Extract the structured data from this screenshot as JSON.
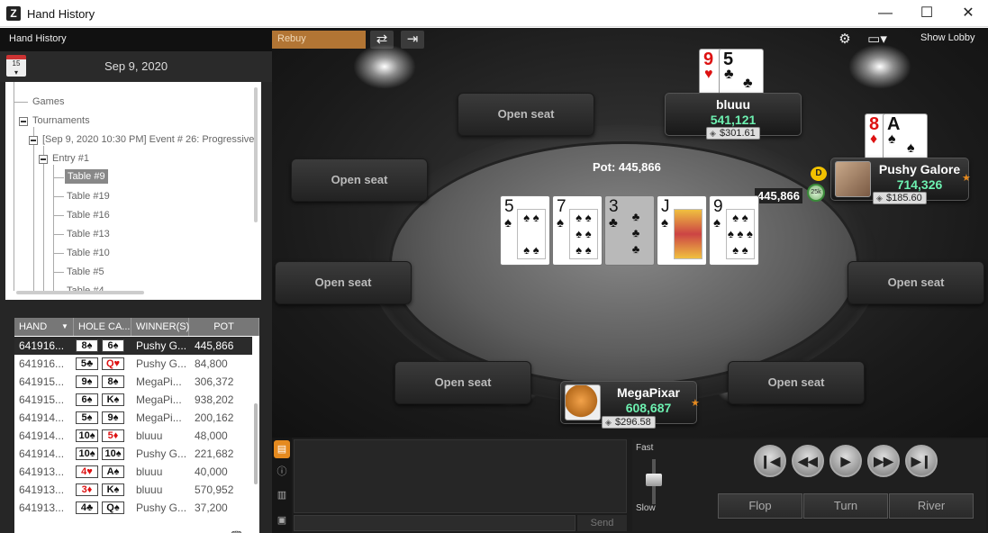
{
  "window": {
    "title": "Hand History",
    "min": "—",
    "max": "☐",
    "close": "✕"
  },
  "left": {
    "header": "Hand History",
    "date": "Sep 9, 2020",
    "calendar_day": "15",
    "tree": {
      "games": "Games",
      "tournaments": "Tournaments",
      "event": "[Sep 9, 2020 10:30 PM] Event # 26: Progressive",
      "entry": "Entry #1",
      "tables": [
        "Table #9",
        "Table #19",
        "Table #16",
        "Table #13",
        "Table #10",
        "Table #5",
        "Table #4"
      ]
    },
    "columns": [
      "HAND",
      "HOLE CA...",
      "WINNER(S)",
      "POT"
    ],
    "rows": [
      {
        "hand": "641916...",
        "c1": "8♠",
        "c1red": false,
        "c2": "6♠",
        "c2red": false,
        "winner": "Pushy G...",
        "pot": "445,866"
      },
      {
        "hand": "641916...",
        "c1": "5♣",
        "c1red": false,
        "c2": "Q♥",
        "c2red": true,
        "winner": "Pushy G...",
        "pot": "84,800"
      },
      {
        "hand": "641915...",
        "c1": "9♠",
        "c1red": false,
        "c2": "8♠",
        "c2red": false,
        "winner": "MegaPi...",
        "pot": "306,372"
      },
      {
        "hand": "641915...",
        "c1": "6♠",
        "c1red": false,
        "c2": "K♠",
        "c2red": false,
        "winner": "MegaPi...",
        "pot": "938,202"
      },
      {
        "hand": "641914...",
        "c1": "5♠",
        "c1red": false,
        "c2": "9♠",
        "c2red": false,
        "winner": "MegaPi...",
        "pot": "200,162"
      },
      {
        "hand": "641914...",
        "c1": "10♠",
        "c1red": false,
        "c2": "5♦",
        "c2red": true,
        "winner": "bluuu",
        "pot": "48,000"
      },
      {
        "hand": "641914...",
        "c1": "10♠",
        "c1red": false,
        "c2": "10♠",
        "c2red": false,
        "winner": "Pushy G...",
        "pot": "221,682"
      },
      {
        "hand": "641913...",
        "c1": "4♥",
        "c1red": true,
        "c2": "A♠",
        "c2red": false,
        "winner": "bluuu",
        "pot": "40,000"
      },
      {
        "hand": "641913...",
        "c1": "3♦",
        "c1red": true,
        "c2": "K♠",
        "c2red": false,
        "winner": "bluuu",
        "pot": "570,952"
      },
      {
        "hand": "641913...",
        "c1": "4♣",
        "c1red": false,
        "c2": "Q♠",
        "c2red": false,
        "winner": "Pushy G...",
        "pot": "37,200"
      }
    ]
  },
  "toolbar": {
    "rebuy": "Rebuy",
    "show_lobby": "Show Lobby"
  },
  "table": {
    "pot_label": "Pot: 445,866",
    "bet": "445,866",
    "dealer": "D",
    "chip": "25k",
    "open_seat": "Open seat",
    "players": {
      "bluuu": {
        "name": "bluuu",
        "stack": "541,121",
        "bank": "$301.61",
        "cards": [
          {
            "r": "9",
            "s": "♥",
            "red": true
          },
          {
            "r": "5",
            "s": "♣",
            "red": false
          }
        ]
      },
      "pushy": {
        "name": "Pushy Galore",
        "stack": "714,326",
        "bank": "$185.60",
        "cards": [
          {
            "r": "8",
            "s": "♦",
            "red": true
          },
          {
            "r": "A",
            "s": "♠",
            "red": false
          }
        ]
      },
      "mega": {
        "name": "MegaPixar",
        "stack": "608,687",
        "bank": "$296.58"
      }
    },
    "board": [
      {
        "r": "5",
        "s": "♠",
        "red": false
      },
      {
        "r": "7",
        "s": "♠",
        "red": false
      },
      {
        "r": "3",
        "s": "♣",
        "red": false,
        "dim": true
      },
      {
        "r": "J",
        "s": "♠",
        "red": false,
        "face": true
      },
      {
        "r": "9",
        "s": "♠",
        "red": false
      }
    ]
  },
  "bottom": {
    "send": "Send",
    "fast": "Fast",
    "slow": "Slow",
    "streets": [
      "Flop",
      "Turn",
      "River"
    ]
  },
  "colors": {
    "accent": "#b27534",
    "stack": "#6df0b0",
    "highlight": "#e58a1f"
  }
}
